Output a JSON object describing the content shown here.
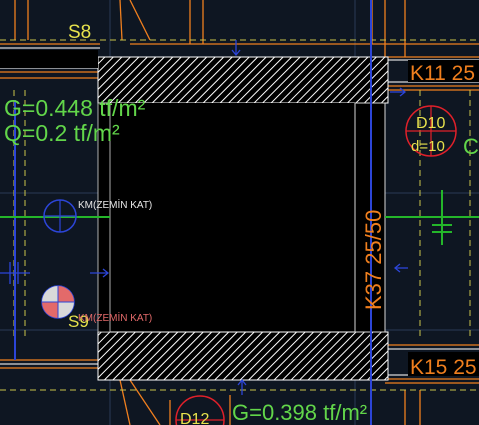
{
  "drawing": {
    "labels": {
      "s8": "S8",
      "s9": "S9",
      "k11": "K11 25",
      "k15": "K15 25",
      "k37": "K37 25/50",
      "d10": "D10",
      "d10_diameter": "d=10",
      "d12": "D12",
      "g_top": "G=0.448 tf/m²",
      "q_top": "Q=0.2 tf/m²",
      "g_bottom": "G=0.398 tf/m²",
      "km_upper": "KM(ZEMİN KAT)",
      "km_lower": "KM(ZEMİN KAT)",
      "edge_letter": "C"
    },
    "colors": {
      "background": "#0e1622",
      "load_text": "#62d64a",
      "beam_label": "#f07f1e",
      "slab_label": "#e7e24c",
      "node_marker": "#e0202a",
      "axis_blue": "#2c45d8",
      "axis_green": "#24b62a",
      "hatch": "#ffffff",
      "void_fill": "#000000"
    }
  }
}
